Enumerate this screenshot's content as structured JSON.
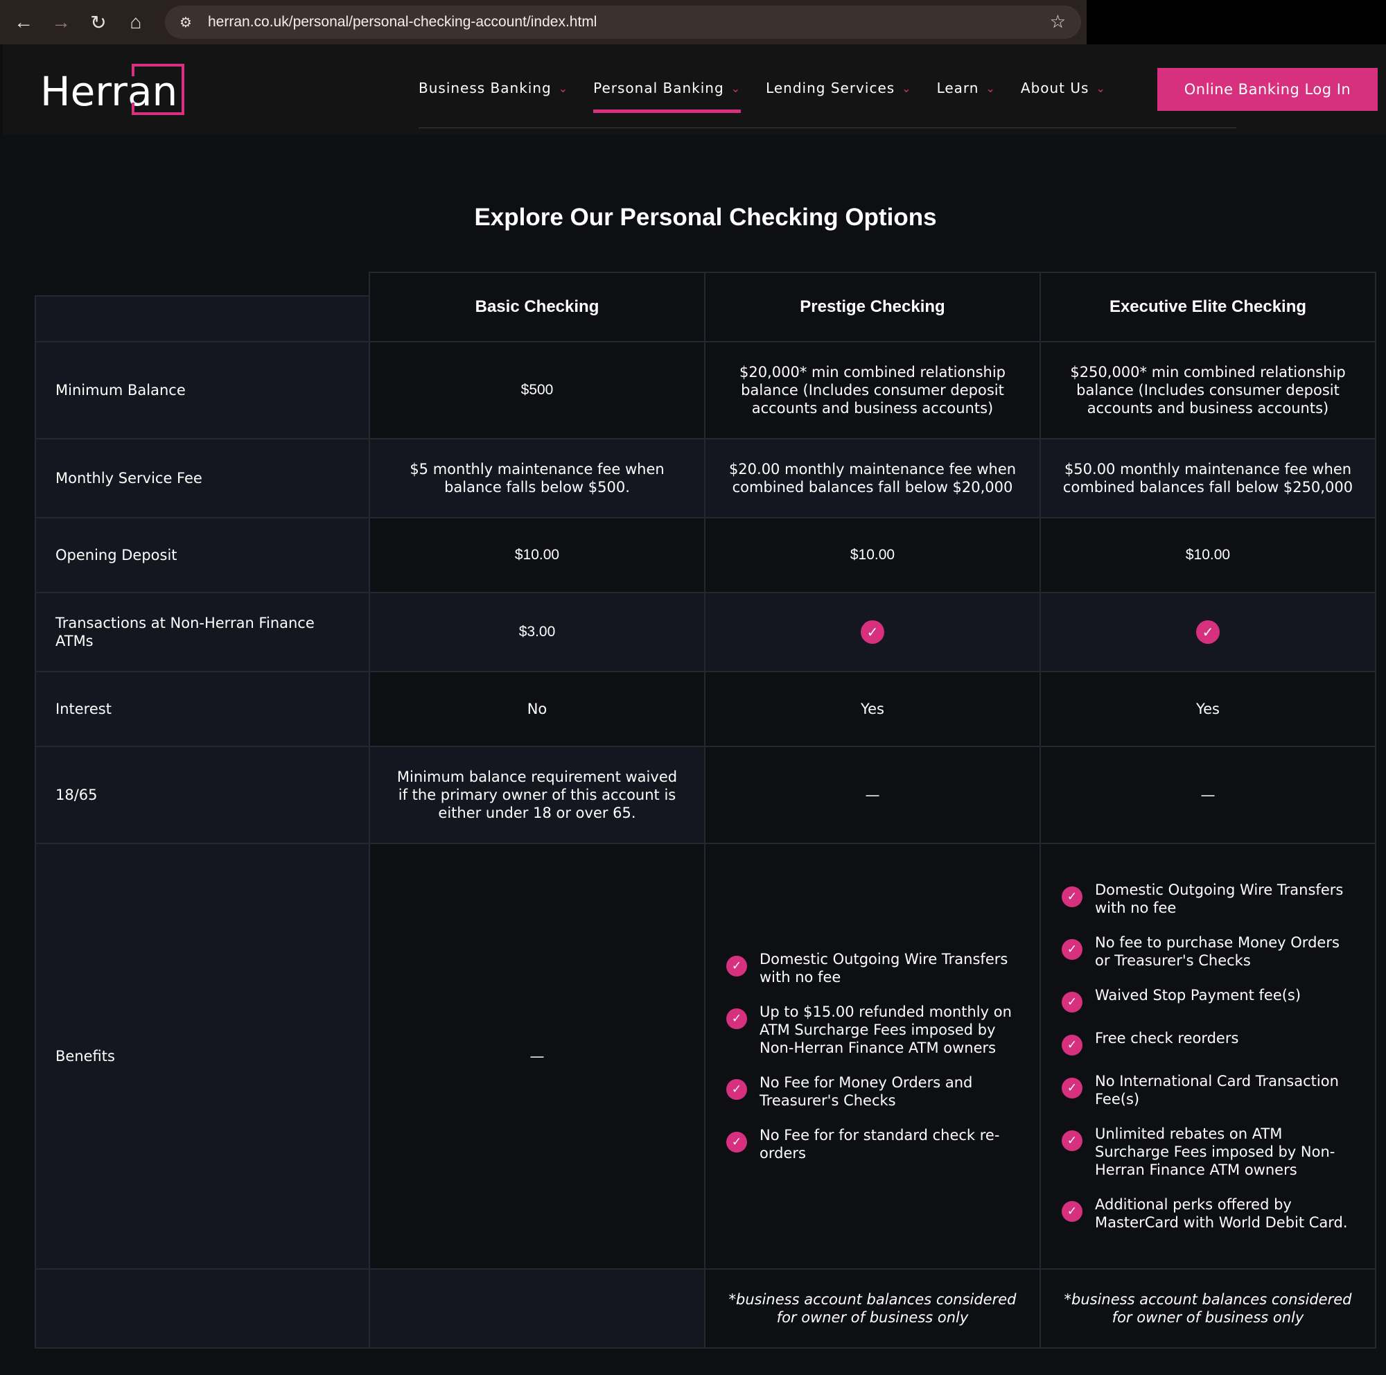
{
  "browser": {
    "url": "herran.co.uk/personal/personal-checking-account/index.html"
  },
  "header": {
    "logo_text": "Herran",
    "nav": [
      {
        "label": "Business Banking"
      },
      {
        "label": "Personal Banking",
        "active": true
      },
      {
        "label": "Lending Services"
      },
      {
        "label": "Learn"
      },
      {
        "label": "About Us"
      }
    ],
    "login_label": "Online Banking Log In"
  },
  "main": {
    "title": "Explore Our Personal Checking Options",
    "columns": [
      "Basic Checking",
      "Prestige Checking",
      "Executive Elite Checking"
    ],
    "rows": [
      {
        "label": "Minimum Balance",
        "values": [
          "$500",
          "$20,000* min combined relationship balance (Includes consumer deposit accounts and business accounts)",
          "$250,000* min combined relationship balance (Includes consumer deposit accounts and business accounts)"
        ]
      },
      {
        "label": "Monthly Service Fee",
        "values": [
          "$5 monthly maintenance fee when balance falls below $500.",
          "$20.00 monthly maintenance fee when combined balances fall below $20,000",
          "$50.00 monthly maintenance fee when combined balances fall below $250,000"
        ]
      },
      {
        "label": "Opening Deposit",
        "values": [
          "$10.00",
          "$10.00",
          "$10.00"
        ]
      },
      {
        "label": "Transactions at Non-Herran Finance ATMs",
        "values": [
          "$3.00",
          "✓",
          "✓"
        ]
      },
      {
        "label": "Interest",
        "values": [
          "No",
          "Yes",
          "Yes"
        ]
      },
      {
        "label": "18/65",
        "values": [
          "Minimum balance requirement waived if the primary owner of this account is either under 18 or over 65.",
          "—",
          "—"
        ]
      }
    ],
    "benefits": {
      "label": "Benefits",
      "basic": "—",
      "prestige": [
        "Domestic Outgoing Wire Transfers with no fee",
        "Up to $15.00 refunded monthly on ATM Surcharge Fees imposed by Non-Herran Finance ATM owners",
        "No Fee for Money Orders and Treasurer's Checks",
        "No Fee for for standard check re-orders"
      ],
      "elite": [
        "Domestic Outgoing Wire Transfers with no fee",
        "No fee to purchase Money Orders or Treasurer's Checks",
        "Waived Stop Payment fee(s)",
        "Free check reorders",
        "No International Card Transaction Fee(s)",
        "Unlimited rebates on ATM Surcharge Fees imposed by Non-Herran Finance ATM owners",
        "Additional perks offered by MasterCard with World Debit Card."
      ]
    },
    "footnotes": [
      "*business account balances considered for owner of business only",
      "*business account balances considered for owner of business only"
    ]
  },
  "colors": {
    "accent": "#d6307e",
    "bg": "#0e0f13",
    "row_alt": "#141720"
  }
}
